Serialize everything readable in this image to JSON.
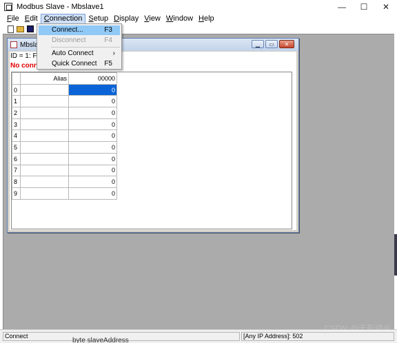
{
  "app": {
    "title": "Modbus Slave - Mbslave1",
    "minimize": "—",
    "maximize": "☐",
    "close": "✕"
  },
  "menubar": [
    {
      "label": "File",
      "u": "F",
      "rest": "ile"
    },
    {
      "label": "Edit",
      "u": "E",
      "rest": "dit"
    },
    {
      "label": "Connection",
      "u": "C",
      "rest": "onnection"
    },
    {
      "label": "Setup",
      "u": "S",
      "rest": "etup"
    },
    {
      "label": "Display",
      "u": "D",
      "rest": "isplay"
    },
    {
      "label": "View",
      "u": "V",
      "rest": "iew"
    },
    {
      "label": "Window",
      "u": "W",
      "rest": "indow"
    },
    {
      "label": "Help",
      "u": "H",
      "rest": "elp"
    }
  ],
  "connection_menu": {
    "connect": {
      "label": "Connect...",
      "shortcut": "F3"
    },
    "disconnect": {
      "label": "Disconnect",
      "shortcut": "F4"
    },
    "auto_connect": {
      "label": "Auto Connect",
      "arrow": "›"
    },
    "quick_connect": {
      "label": "Quick Connect",
      "shortcut": "F5"
    }
  },
  "child": {
    "title": "Mbsla",
    "id_line": "ID = 1: F",
    "status_line": "No conne",
    "grid": {
      "alias_header": "Alias",
      "value_header": "00000",
      "rows": [
        {
          "idx": "0",
          "value": "0"
        },
        {
          "idx": "1",
          "value": "0"
        },
        {
          "idx": "2",
          "value": "0"
        },
        {
          "idx": "3",
          "value": "0"
        },
        {
          "idx": "4",
          "value": "0"
        },
        {
          "idx": "5",
          "value": "0"
        },
        {
          "idx": "6",
          "value": "0"
        },
        {
          "idx": "7",
          "value": "0"
        },
        {
          "idx": "8",
          "value": "0"
        },
        {
          "idx": "9",
          "value": "0"
        }
      ]
    }
  },
  "statusbar": {
    "left": "Connect",
    "right": "[Any IP Address]: 502"
  },
  "watermark": "CSDN @无形道长",
  "background_text": "byte slaveAddress"
}
